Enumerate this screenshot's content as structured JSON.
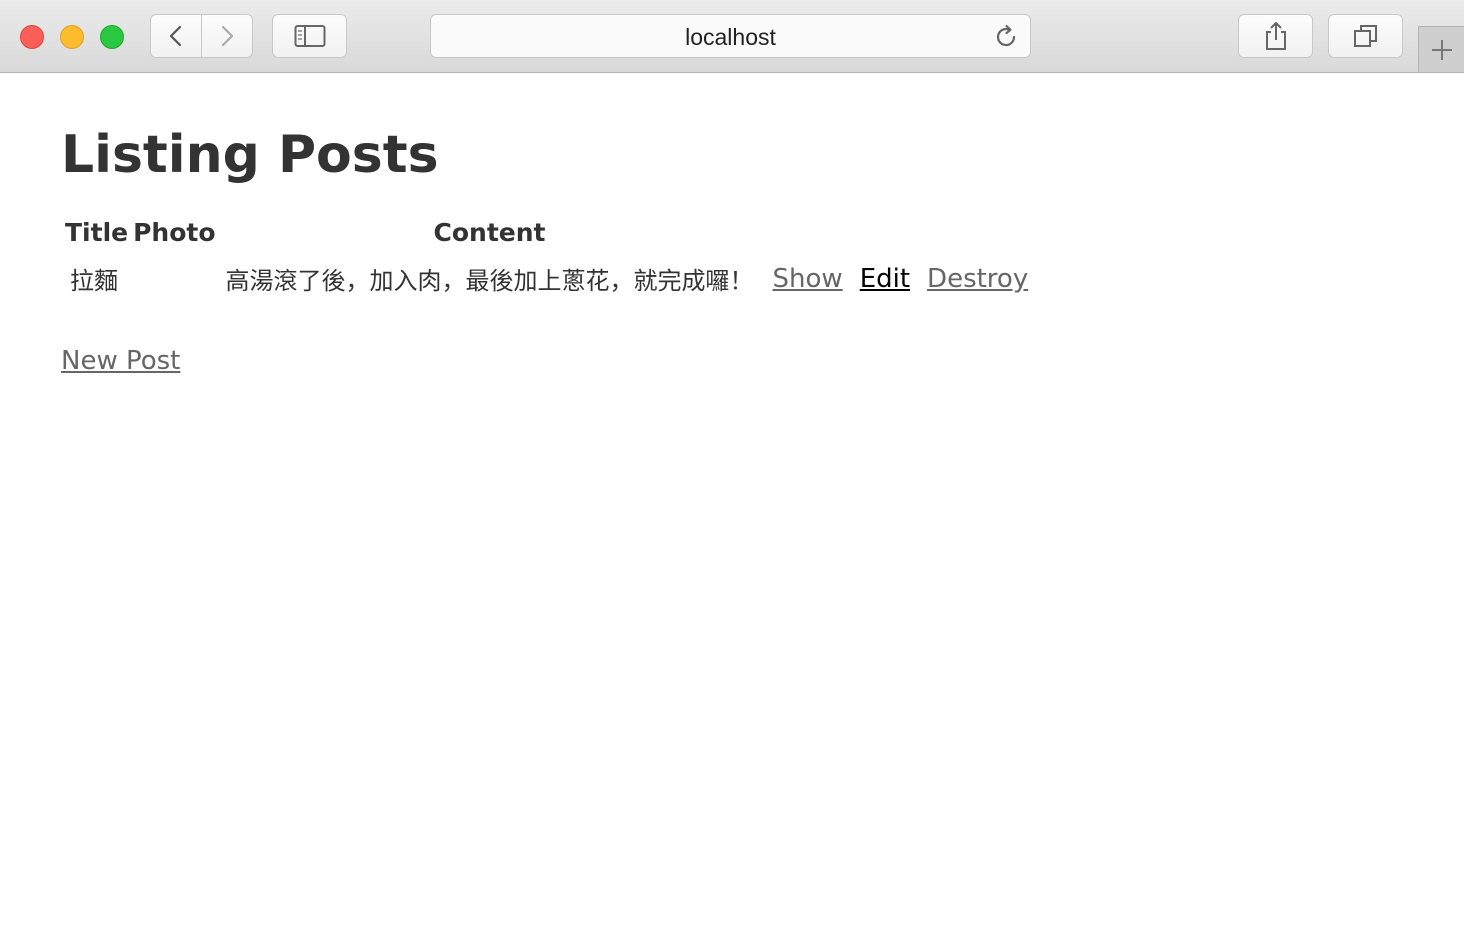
{
  "browser": {
    "url": "localhost"
  },
  "page": {
    "title": "Listing Posts",
    "table": {
      "headers": {
        "title": "Title",
        "photo": "Photo",
        "content": "Content"
      },
      "rows": [
        {
          "title": "拉麵",
          "photo": "",
          "content": "高湯滾了後，加入肉，最後加上蔥花，就完成囉！",
          "show": "Show",
          "edit": "Edit",
          "destroy": "Destroy"
        }
      ]
    },
    "new_post_label": "New Post"
  },
  "icons": {
    "back": "chevron-left-icon",
    "forward": "chevron-right-icon",
    "sidebar": "sidebar-icon",
    "reload": "reload-icon",
    "share": "share-icon",
    "tabs": "tabs-overview-icon",
    "new_tab": "plus-icon"
  },
  "colors": {
    "close": "#fc5f57",
    "minimize": "#fdbc2e",
    "maximize": "#29c840",
    "heading": "#333333",
    "link": "#666666",
    "visited_link": "#000000"
  }
}
